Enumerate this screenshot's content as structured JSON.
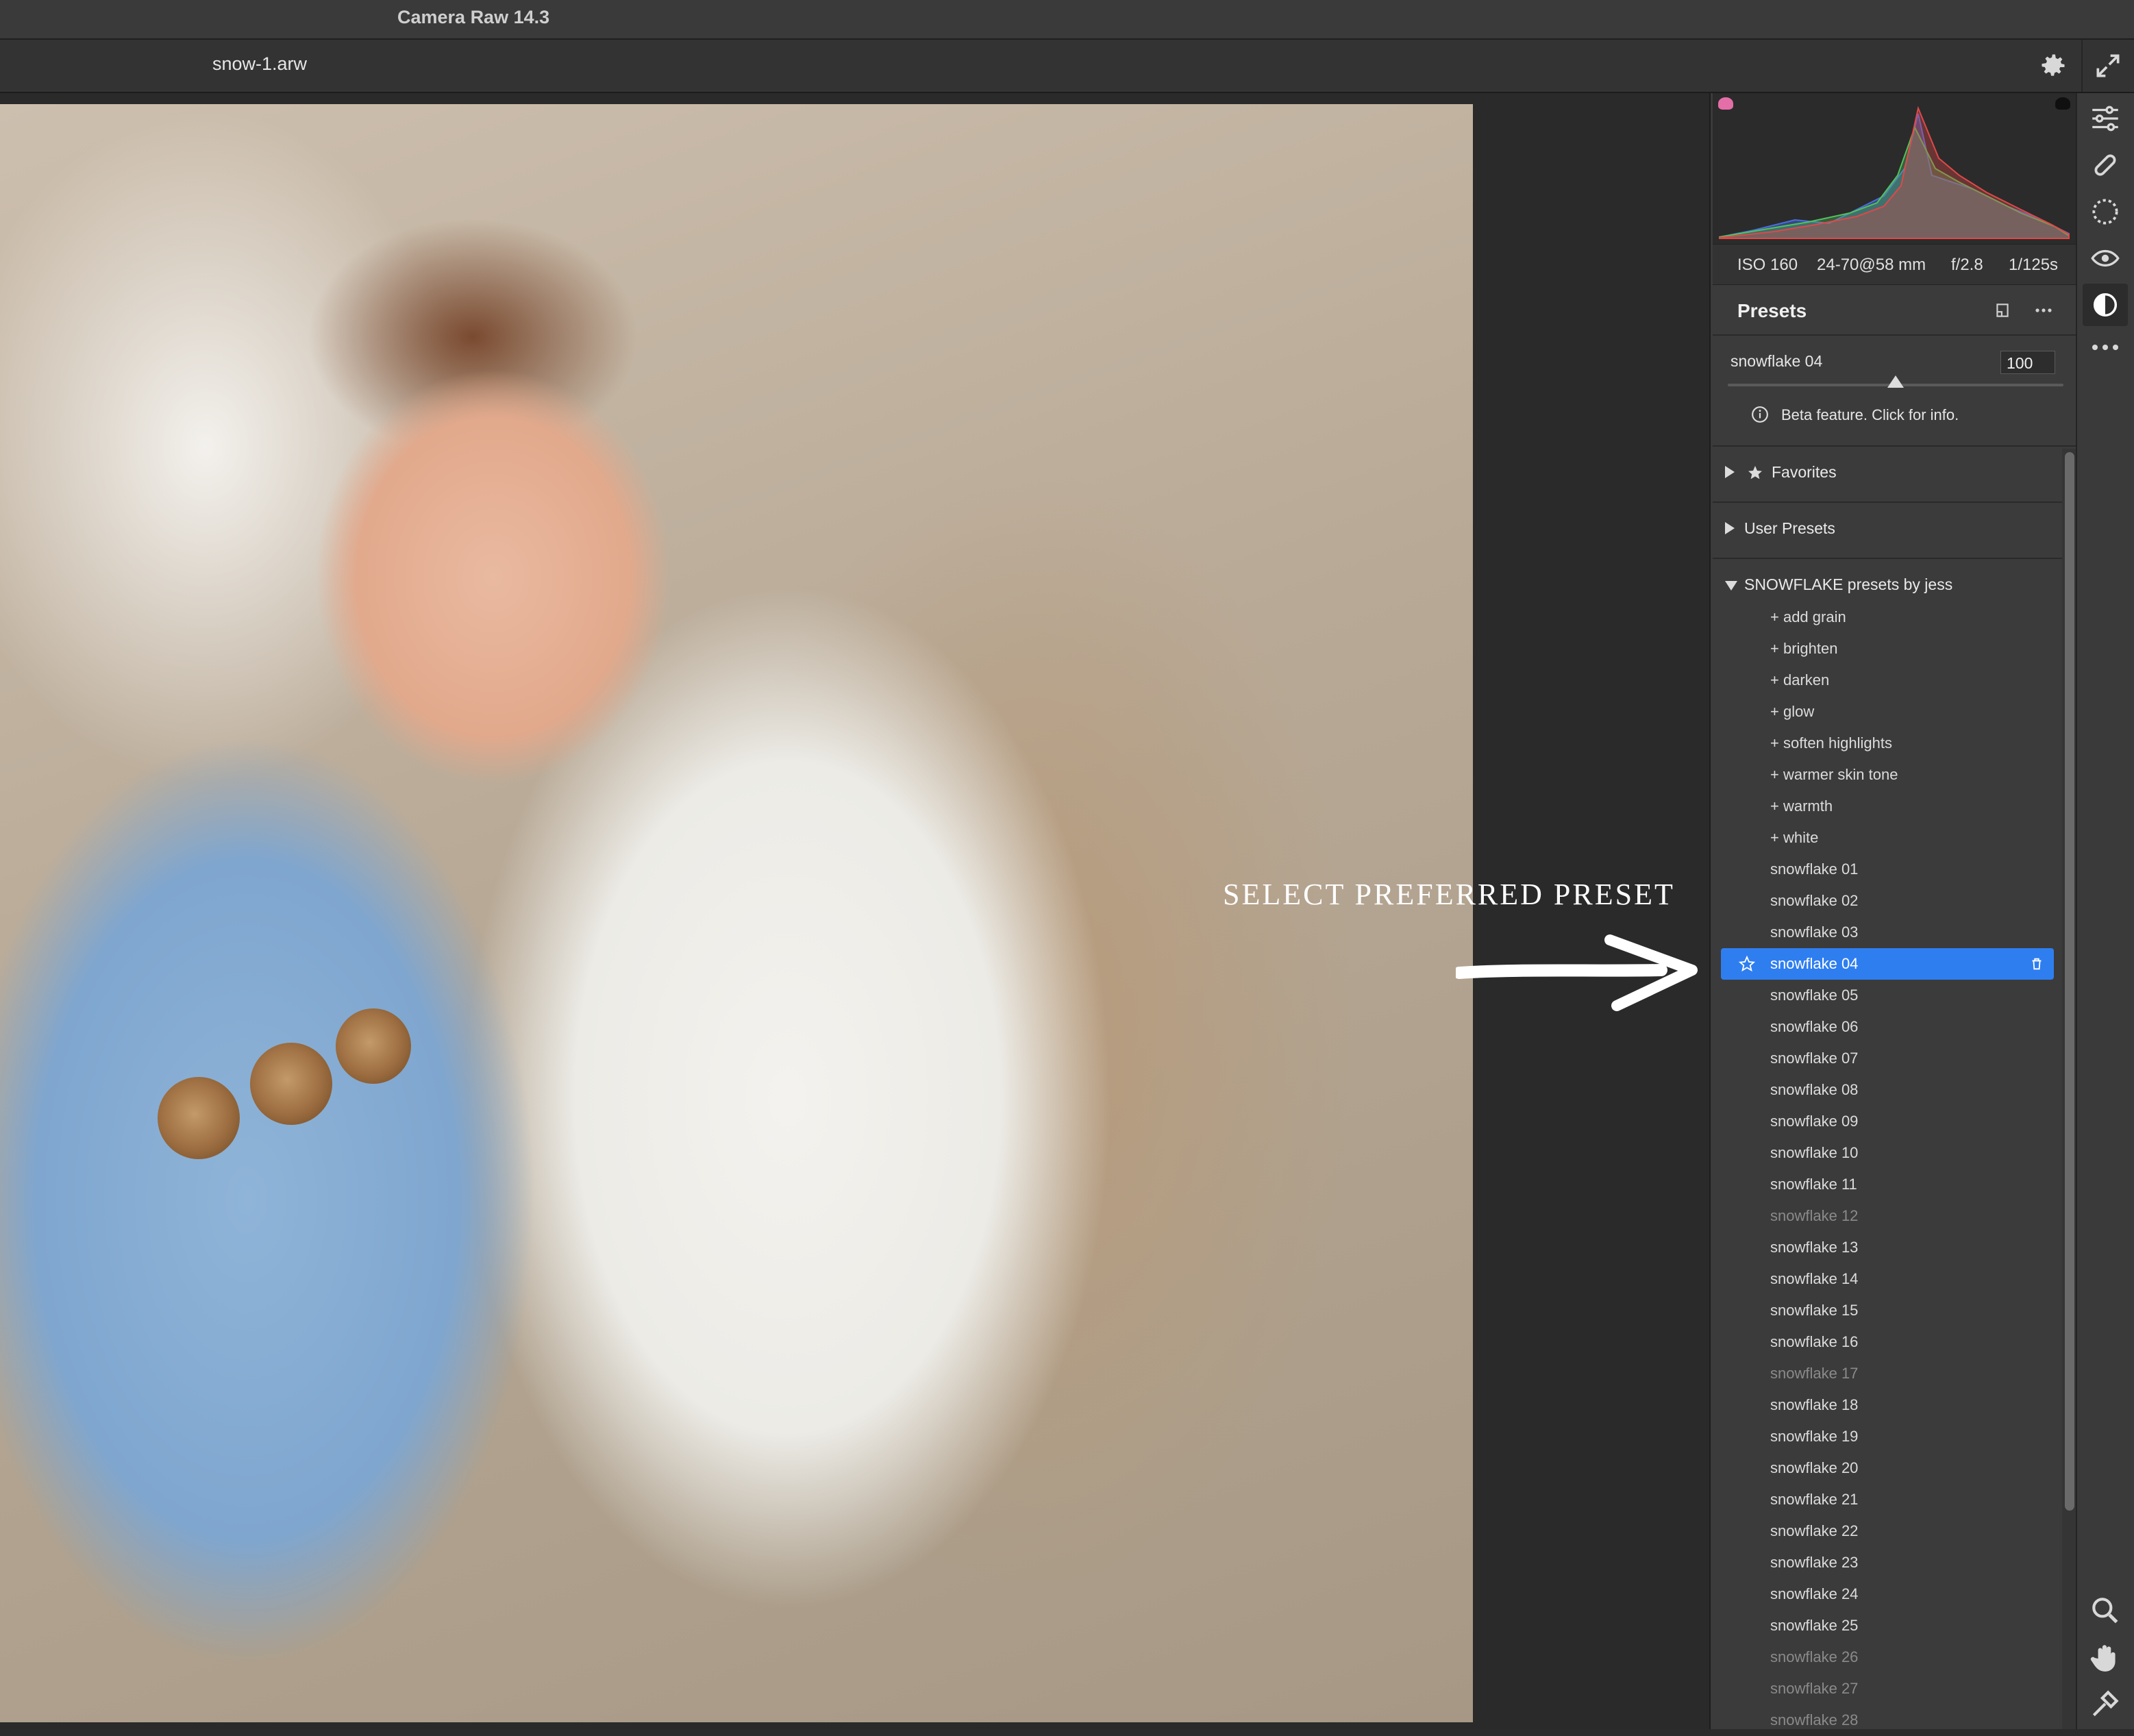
{
  "app": {
    "title": "Camera Raw 14.3"
  },
  "file": {
    "name": "snow-1.arw"
  },
  "exif": {
    "iso": "ISO 160",
    "lens": "24-70@58 mm",
    "aperture": "f/2.8",
    "shutter": "1/125s"
  },
  "photo": {
    "caption": "SELECT PREFERRED PRESET"
  },
  "presets": {
    "title": "Presets",
    "amount_label": "snowflake 04",
    "amount_value": "100",
    "amount_percent": 100,
    "beta_text": "Beta feature. Click for info.",
    "groups": [
      {
        "label": "Favorites",
        "expanded": false
      },
      {
        "label": "User Presets",
        "expanded": false
      },
      {
        "label": "SNOWFLAKE presets by jess",
        "expanded": true
      }
    ],
    "items": [
      {
        "label": "+ add grain",
        "state": "normal"
      },
      {
        "label": "+ brighten",
        "state": "normal"
      },
      {
        "label": "+ darken",
        "state": "normal"
      },
      {
        "label": "+ glow",
        "state": "normal"
      },
      {
        "label": "+ soften highlights",
        "state": "normal"
      },
      {
        "label": "+ warmer skin tone",
        "state": "normal"
      },
      {
        "label": "+ warmth",
        "state": "normal"
      },
      {
        "label": "+ white",
        "state": "normal"
      },
      {
        "label": "snowflake 01",
        "state": "normal"
      },
      {
        "label": "snowflake 02",
        "state": "normal"
      },
      {
        "label": "snowflake 03",
        "state": "normal"
      },
      {
        "label": "snowflake 04",
        "state": "selected"
      },
      {
        "label": "snowflake 05",
        "state": "normal"
      },
      {
        "label": "snowflake 06",
        "state": "normal"
      },
      {
        "label": "snowflake 07",
        "state": "normal"
      },
      {
        "label": "snowflake 08",
        "state": "normal"
      },
      {
        "label": "snowflake 09",
        "state": "normal"
      },
      {
        "label": "snowflake 10",
        "state": "normal"
      },
      {
        "label": "snowflake 11",
        "state": "normal"
      },
      {
        "label": "snowflake 12",
        "state": "dim"
      },
      {
        "label": "snowflake 13",
        "state": "normal"
      },
      {
        "label": "snowflake 14",
        "state": "normal"
      },
      {
        "label": "snowflake 15",
        "state": "normal"
      },
      {
        "label": "snowflake 16",
        "state": "normal"
      },
      {
        "label": "snowflake 17",
        "state": "dim"
      },
      {
        "label": "snowflake 18",
        "state": "normal"
      },
      {
        "label": "snowflake 19",
        "state": "normal"
      },
      {
        "label": "snowflake 20",
        "state": "normal"
      },
      {
        "label": "snowflake 21",
        "state": "normal"
      },
      {
        "label": "snowflake 22",
        "state": "normal"
      },
      {
        "label": "snowflake 23",
        "state": "normal"
      },
      {
        "label": "snowflake 24",
        "state": "normal"
      },
      {
        "label": "snowflake 25",
        "state": "normal"
      },
      {
        "label": "snowflake 26",
        "state": "dim"
      },
      {
        "label": "snowflake 27",
        "state": "dim"
      },
      {
        "label": "snowflake 28",
        "state": "dim"
      }
    ]
  },
  "colors": {
    "accent": "#2f7ef0",
    "panel": "#3b3b3b",
    "background": "#2b2b2b"
  },
  "icons": {
    "toolbar": [
      "gear-icon",
      "expand-icon"
    ],
    "toolstrip": [
      "edit-sliders-icon",
      "healing-brush-icon",
      "masking-icon",
      "red-eye-icon",
      "presets-icon",
      "more-icon",
      "zoom-icon",
      "hand-icon",
      "sampler-icon"
    ]
  }
}
